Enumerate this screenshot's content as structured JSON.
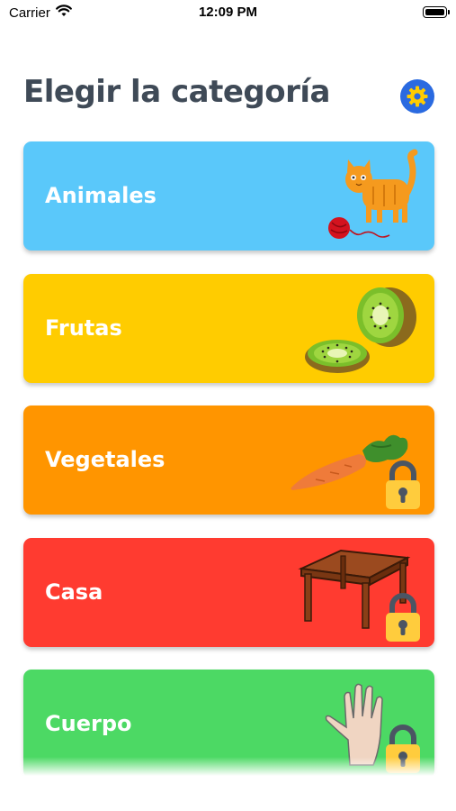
{
  "status_bar": {
    "carrier": "Carrier",
    "time": "12:09 PM"
  },
  "header": {
    "title": "Elegir la categoría",
    "settings_icon": "gear-icon"
  },
  "categories": [
    {
      "label": "Animales",
      "color": "#5ac8fa",
      "icon": "cat-icon",
      "locked": false
    },
    {
      "label": "Frutas",
      "color": "#ffcc00",
      "icon": "kiwi-icon",
      "locked": false
    },
    {
      "label": "Vegetales",
      "color": "#ff9500",
      "icon": "carrot-icon",
      "locked": true
    },
    {
      "label": "Casa",
      "color": "#ff3b30",
      "icon": "table-icon",
      "locked": true
    },
    {
      "label": "Cuerpo",
      "color": "#4cd964",
      "icon": "hand-icon",
      "locked": true
    }
  ]
}
